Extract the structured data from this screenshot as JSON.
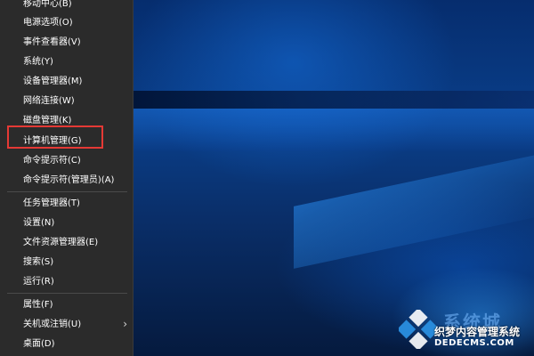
{
  "menu": {
    "items": [
      {
        "label": "移动中心(B)"
      },
      {
        "label": "电源选项(O)"
      },
      {
        "label": "事件查看器(V)"
      },
      {
        "label": "系统(Y)"
      },
      {
        "label": "设备管理器(M)"
      },
      {
        "label": "网络连接(W)"
      },
      {
        "label": "磁盘管理(K)"
      },
      {
        "label": "计算机管理(G)"
      },
      {
        "label": "命令提示符(C)"
      },
      {
        "label": "命令提示符(管理员)(A)"
      },
      {
        "label": "任务管理器(T)"
      },
      {
        "label": "设置(N)"
      },
      {
        "label": "文件资源管理器(E)"
      },
      {
        "label": "搜索(S)"
      },
      {
        "label": "运行(R)"
      },
      {
        "label": "属性(F)"
      },
      {
        "label": "关机或注销(U)"
      },
      {
        "label": "桌面(D)"
      }
    ],
    "submenu_arrow": "›"
  },
  "watermark": {
    "title": "系统城",
    "subtitle": "织梦内容管理系统",
    "url": "DEDECMS.COM"
  },
  "colors": {
    "menu_bg": "#2b2b2b",
    "menu_text": "#ffffff",
    "highlight": "#e53935",
    "desktop": "#0a3f8a"
  }
}
